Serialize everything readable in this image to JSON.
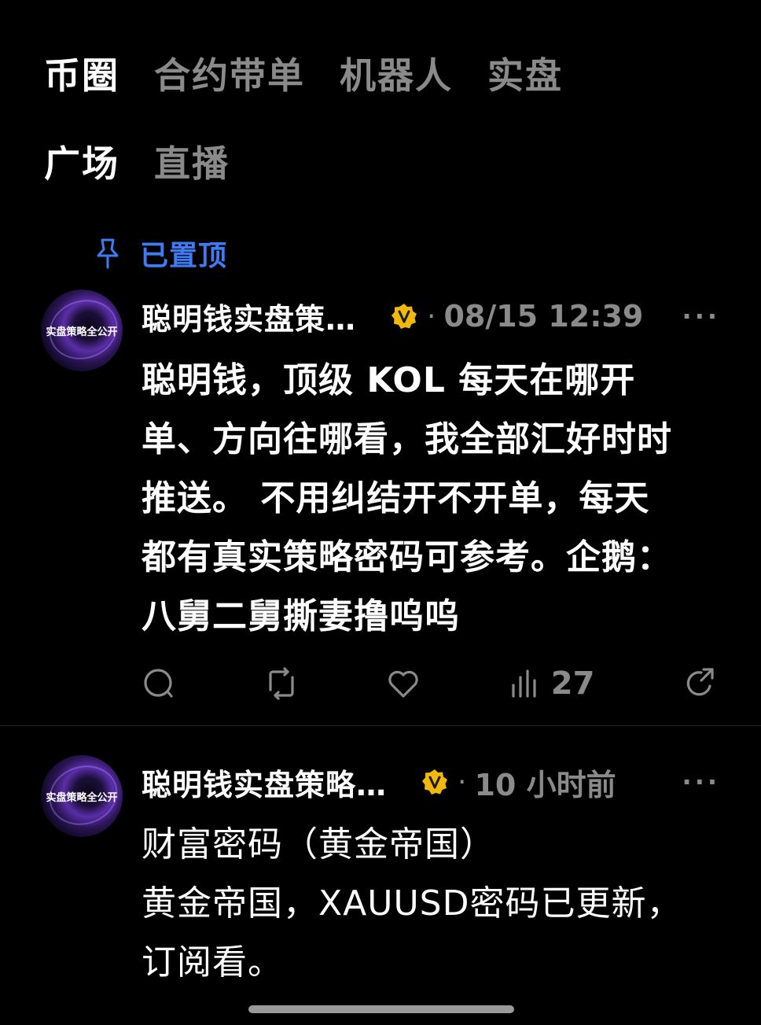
{
  "nav": {
    "primary_tabs": [
      {
        "label": "币圈",
        "active": true
      },
      {
        "label": "合约带单",
        "active": false
      },
      {
        "label": "机器人",
        "active": false
      },
      {
        "label": "实盘",
        "active": false
      }
    ],
    "secondary_tabs": [
      {
        "label": "广场",
        "active": true
      },
      {
        "label": "直播",
        "active": false
      }
    ]
  },
  "pinned": {
    "label": "已置顶",
    "icon": "pin-icon",
    "color": "#3d7cf5"
  },
  "posts": [
    {
      "avatar_text": "实盘策略全公开",
      "author": "聪明钱实盘策…",
      "verified": true,
      "separator": "·",
      "time": "08/15 12:39",
      "more": "···",
      "content_lines": [
        "聪明钱，顶级 KOL 每天在哪开",
        "单、方向往哪看，我全部汇好时时",
        "推送。 不用纠结开不开单，每天",
        "都有真实策略密码可参考。企鹅：",
        "八舅二舅撕妻撸呜呜"
      ],
      "actions": {
        "comment_icon": "comment-icon",
        "repost_icon": "repost-icon",
        "like_icon": "heart-icon",
        "views_icon": "views-icon",
        "views": "27",
        "share_icon": "share-icon"
      }
    },
    {
      "avatar_text": "实盘策略全公开",
      "author": "聪明钱实盘策略…",
      "verified": true,
      "separator": "·",
      "time": "10 小时前",
      "more": "···",
      "content_lines": [
        "财富密码（黄金帝国）",
        "黄金帝国，XAUUSD密码已更新，",
        "订阅看。"
      ]
    }
  ],
  "colors": {
    "background": "#000000",
    "muted": "#8a8a8a",
    "accent": "#3d7cf5",
    "verified": "#f0b90b"
  }
}
